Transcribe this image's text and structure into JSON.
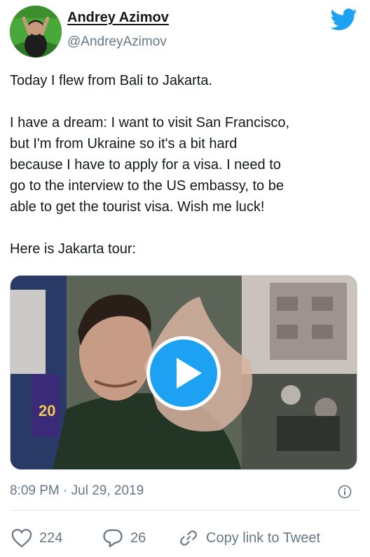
{
  "author": {
    "name": "Andrey Azimov",
    "handle": "@AndreyAzimov"
  },
  "tweet": {
    "paragraphs": [
      [
        "Today I flew from Bali to Jakarta."
      ],
      [
        "I have a dream: I want to visit San Francisco,",
        "but I'm from Ukraine so it's a bit hard",
        "because I have to apply for a visa. I need to",
        "go to the interview to the US embassy, to be",
        "able to get the tourist visa. Wish me luck!"
      ],
      [
        "Here is Jakarta tour:"
      ]
    ],
    "timestamp": "8:09 PM · Jul 29, 2019"
  },
  "media": {
    "type": "video",
    "overlay_text": "20"
  },
  "actions": {
    "like_count": "224",
    "reply_count": "26",
    "copy_link_label": "Copy link to Tweet"
  },
  "icons": {
    "logo": "twitter-bird-icon",
    "info": "info-icon",
    "like": "heart-icon",
    "reply": "speech-bubble-icon",
    "link": "link-icon",
    "play": "play-icon"
  },
  "colors": {
    "accent": "#1da1f2",
    "text": "#14171a",
    "secondary_text": "#657786",
    "divider": "#e1e8ed"
  }
}
